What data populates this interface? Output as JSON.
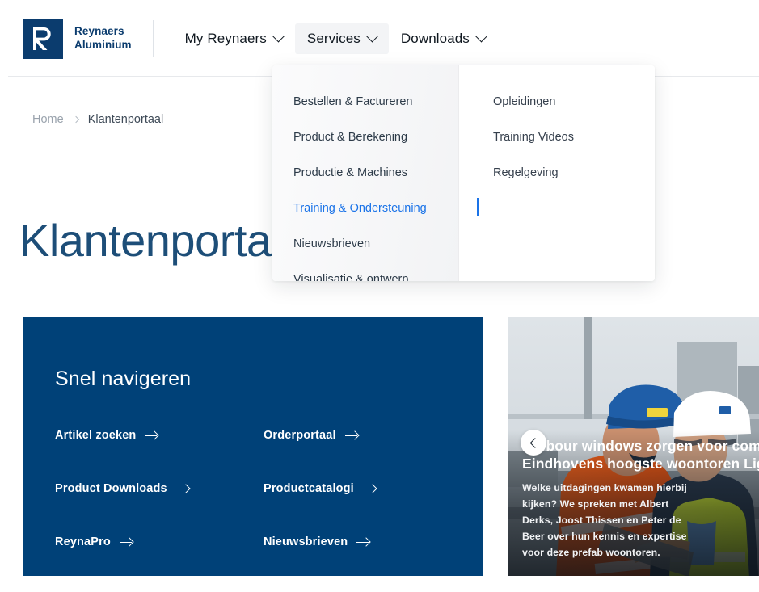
{
  "brand": {
    "name_line1": "Reynaers",
    "name_line2": "Aluminium",
    "logo_letter": "R",
    "logo_bg": "#0b3c6e"
  },
  "nav": {
    "items": [
      {
        "label": "My Reynaers",
        "open": false
      },
      {
        "label": "Services",
        "open": true
      },
      {
        "label": "Downloads",
        "open": false
      }
    ]
  },
  "mega_menu": {
    "left_column": [
      {
        "label": "Bestellen & Factureren",
        "active": false
      },
      {
        "label": "Product & Berekening",
        "active": false
      },
      {
        "label": "Productie & Machines",
        "active": false
      },
      {
        "label": "Training & Ondersteuning",
        "active": true
      },
      {
        "label": "Nieuwsbrieven",
        "active": false
      },
      {
        "label": "Visualisatie & ontwerp",
        "active": false
      }
    ],
    "right_column": [
      {
        "label": "Opleidingen"
      },
      {
        "label": "Training Videos"
      },
      {
        "label": "Regelgeving"
      }
    ],
    "active_color": "#1a73e8"
  },
  "breadcrumb": {
    "home": "Home",
    "current": "Klantenportaal"
  },
  "page": {
    "title": "Klantenportaal",
    "title_color": "#1d4e78"
  },
  "quicknav": {
    "heading": "Snel navigeren",
    "bg_color": "#004178",
    "links": [
      {
        "label": "Artikel zoeken"
      },
      {
        "label": "Orderportaal"
      },
      {
        "label": "Product Downloads"
      },
      {
        "label": "Productcatalogi"
      },
      {
        "label": "ReynaPro"
      },
      {
        "label": "Nieuwsbrieven"
      }
    ]
  },
  "hero": {
    "title_line1": "Harbour windows zorgen voor comfort",
    "title_line2": "Eindhovens hoogste woontoren Lighthouse",
    "body": "Welke uitdagingen kwamen hierbij kijken? We spreken met Albert Derks, Joost Thissen en Peter de Beer over hun kennis en expertise voor deze prefab woontoren.",
    "prev_icon": "chevron-left-icon"
  }
}
